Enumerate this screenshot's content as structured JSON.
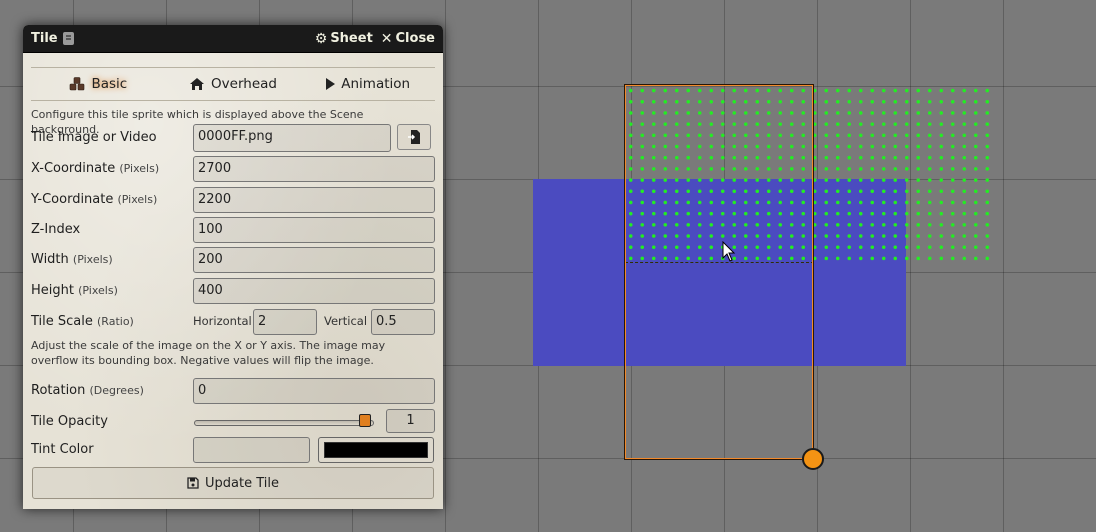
{
  "window": {
    "title": "Tile",
    "sheet_label": "Sheet",
    "close_label": "Close"
  },
  "tabs": [
    {
      "label": "Basic",
      "icon": "cubes-icon",
      "active": true
    },
    {
      "label": "Overhead",
      "icon": "home-icon",
      "active": false
    },
    {
      "label": "Animation",
      "icon": "play-icon",
      "active": false
    }
  ],
  "basic": {
    "hint": "Configure this tile sprite which is displayed above the Scene background.",
    "image_label": "Tile Image or Video",
    "image_value": "0000FF.png",
    "x_label": "X-Coordinate",
    "x_unit": "(Pixels)",
    "x_value": "2700",
    "y_label": "Y-Coordinate",
    "y_unit": "(Pixels)",
    "y_value": "2200",
    "z_label": "Z-Index",
    "z_value": "100",
    "width_label": "Width",
    "width_unit": "(Pixels)",
    "width_value": "200",
    "height_label": "Height",
    "height_unit": "(Pixels)",
    "height_value": "400",
    "scale_label": "Tile Scale",
    "scale_unit": "(Ratio)",
    "horizontal_label": "Horizontal",
    "horizontal_value": "2",
    "vertical_label": "Vertical",
    "vertical_value": "0.5",
    "scale_hint": "Adjust the scale of the image on the X or Y axis. The image may overflow its bounding box. Negative values will flip the image.",
    "rotation_label": "Rotation",
    "rotation_unit": "(Degrees)",
    "rotation_value": "0",
    "opacity_label": "Tile Opacity",
    "opacity_value": "1",
    "tint_label": "Tint Color",
    "tint_value": "",
    "tint_color": "#000000",
    "submit_label": "Update Tile"
  },
  "colors": {
    "accent": "#e07f1f",
    "tile_fill": "#4b4bc0",
    "grid_dots": "#22ee22",
    "header_bg": "#1a1a1a"
  }
}
